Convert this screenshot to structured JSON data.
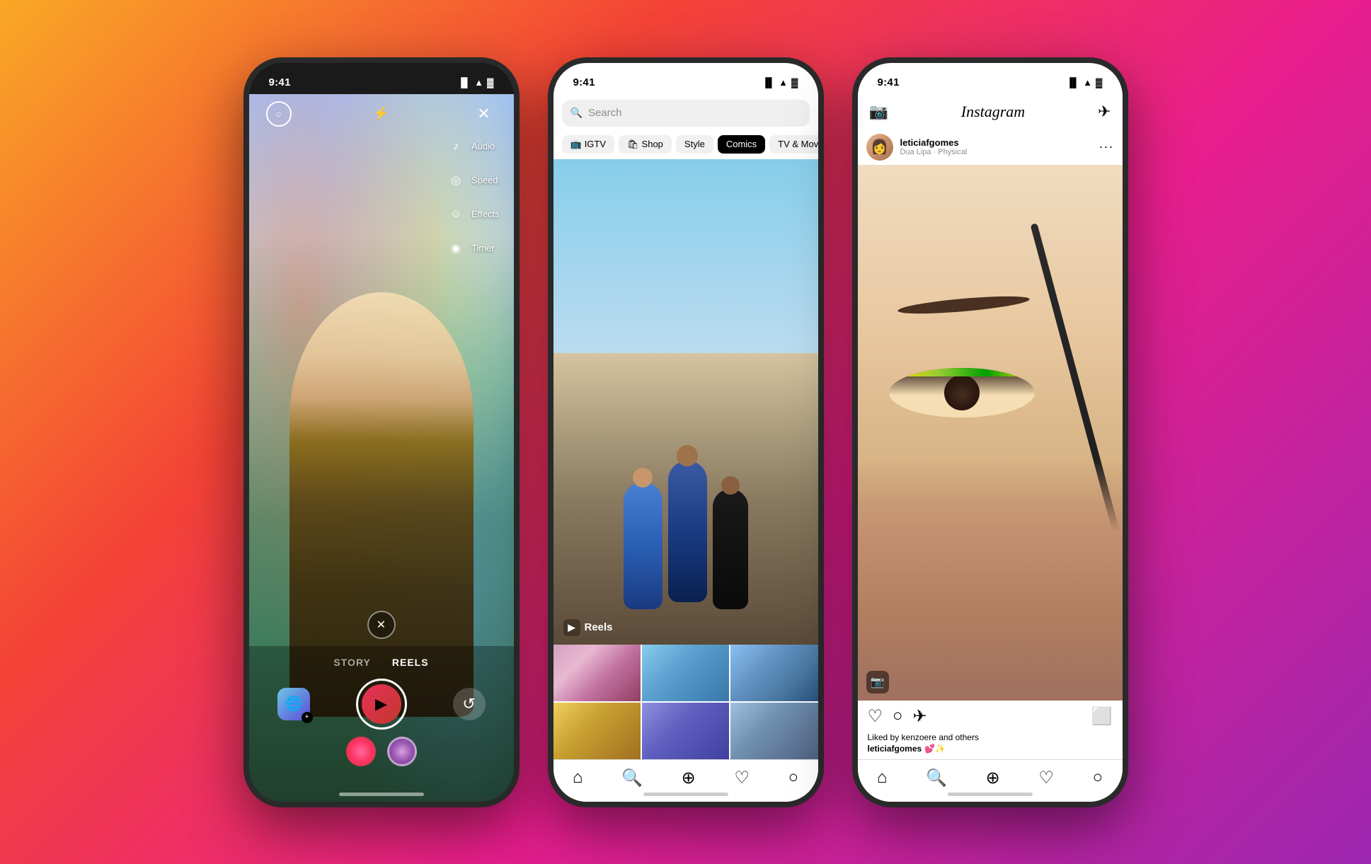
{
  "background": {
    "gradient": "linear-gradient(135deg, #f9a825 0%, #f44336 30%, #e91e8c 60%, #9c27b0 100%)"
  },
  "phone1": {
    "status_time": "9:41",
    "status_icons": "▐▌ ▲ ▓",
    "tools": [
      {
        "icon": "♪",
        "label": "Audio"
      },
      {
        "icon": "◎",
        "label": "Speed"
      },
      {
        "icon": "☺",
        "label": "Effects"
      },
      {
        "icon": "◉",
        "label": "Timer"
      }
    ],
    "modes": [
      "STORY",
      "REELS"
    ],
    "active_mode": "REELS"
  },
  "phone2": {
    "status_time": "9:41",
    "search_placeholder": "Search",
    "categories": [
      "IGTV",
      "Shop",
      "Style",
      "Comics",
      "TV & Movies"
    ],
    "active_category": "Comics",
    "reels_label": "Reels"
  },
  "phone3": {
    "status_time": "9:41",
    "title": "Instagram",
    "username": "leticiafgomes",
    "subtitle": "Dua Lipa · Physical",
    "liked_by": "Liked by kenzoere and others",
    "caption_user": "leticiafgomes",
    "caption_text": "💕✨"
  }
}
